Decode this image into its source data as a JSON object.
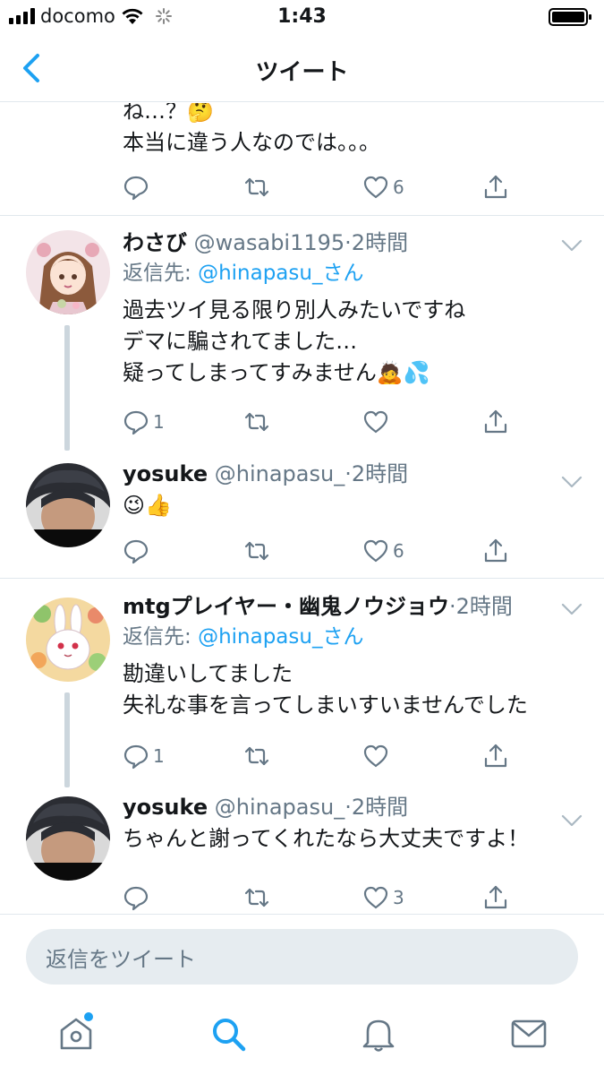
{
  "status_bar": {
    "carrier": "docomo",
    "time": "1:43"
  },
  "nav": {
    "title": "ツイート"
  },
  "tweets": [
    {
      "partial": true,
      "lines": [
        "ね…？🤔",
        "本当に違う人なのでは。。。"
      ],
      "like_count": "6"
    },
    {
      "name": "わさび",
      "handle": "@wasabi1195",
      "time": "·2時間",
      "reply_to_label": "返信先:",
      "reply_to_mention": "@hinapasu_さん",
      "text": "過去ツイ見る限り別人みたいですね\nデマに騙されてました…\n疑ってしまってすみません🙇💦",
      "reply_count": "1",
      "like_count": ""
    },
    {
      "name": "yosuke",
      "handle": "@hinapasu_",
      "time": "·2時間",
      "text": "😉👍",
      "reply_count": "",
      "like_count": "6"
    },
    {
      "name": "mtgプレイヤー・幽鬼ノウジョウ",
      "handle": "",
      "time": "·2時間",
      "reply_to_label": "返信先:",
      "reply_to_mention": "@hinapasu_さん",
      "text": "勘違いしてました\n失礼な事を言ってしまいすいませんでした",
      "reply_count": "1",
      "like_count": ""
    },
    {
      "name": "yosuke",
      "handle": "@hinapasu_",
      "time": "·2時間",
      "text": "ちゃんと謝ってくれたなら大丈夫ですよ！",
      "reply_count": "",
      "like_count": "3"
    }
  ],
  "reply_box": {
    "placeholder": "返信をツイート"
  },
  "tabs": [
    {
      "icon": "home-icon",
      "notification_dot": true
    },
    {
      "icon": "search-icon",
      "active": true
    },
    {
      "icon": "bell-icon"
    },
    {
      "icon": "mail-icon"
    }
  ],
  "colors": {
    "accent": "#1da1f2",
    "muted": "#657786",
    "border": "#e1e8ed",
    "thread": "#ccd6dd"
  }
}
